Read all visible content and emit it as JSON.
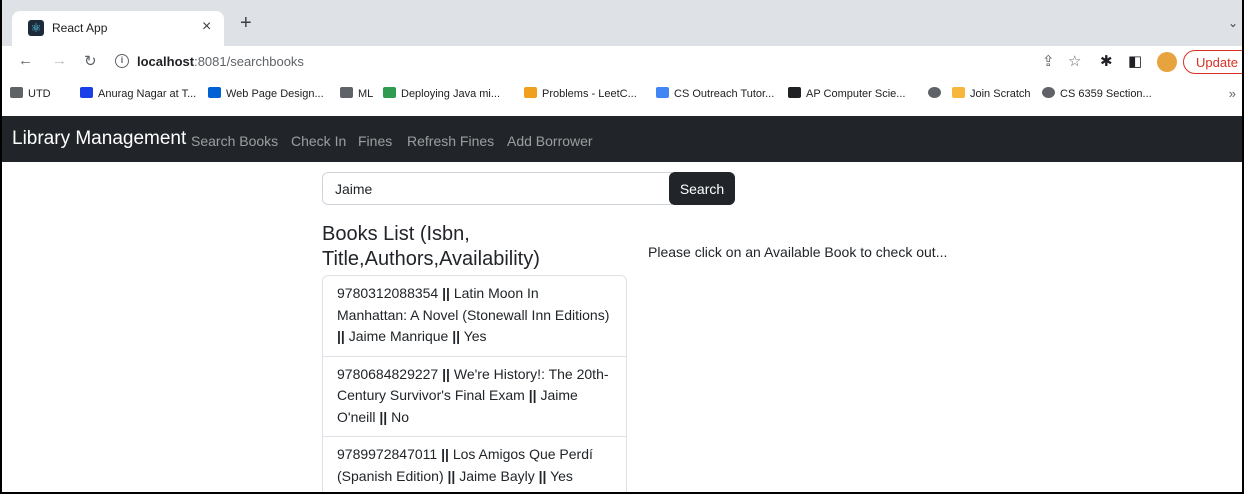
{
  "browser": {
    "tab_title": "React App",
    "url_host": "localhost",
    "url_rest": ":8081/searchbooks",
    "update_label": "Update",
    "bookmarks": [
      {
        "label": "UTD",
        "icon": "folder-icon",
        "color": "#5f6368"
      },
      {
        "label": "Anurag Nagar at T...",
        "icon": "flag-icon",
        "color": "#1a3ee8"
      },
      {
        "label": "Web Page Design...",
        "icon": "box-icon",
        "color": "#0061d5"
      },
      {
        "label": "ML",
        "icon": "folder-icon",
        "color": "#5f6368"
      },
      {
        "label": "Deploying Java mi...",
        "icon": "edge-icon",
        "color": "#2e9b4e"
      },
      {
        "label": "Problems - LeetC...",
        "icon": "leetcode-icon",
        "color": "#f0a01c"
      },
      {
        "label": "CS Outreach Tutor...",
        "icon": "docs-icon",
        "color": "#4285f4"
      },
      {
        "label": "AP Computer Scie...",
        "icon": "collegeboard-icon",
        "color": "#202124"
      },
      {
        "label": "",
        "icon": "globe-icon",
        "color": "#5f6368"
      },
      {
        "label": "Join Scratch",
        "icon": "scratch-icon",
        "color": "#f6b73c"
      },
      {
        "label": "CS 6359 Section...",
        "icon": "globe-icon",
        "color": "#5f6368"
      }
    ]
  },
  "app": {
    "brand": "Library Management",
    "nav": [
      "Search Books",
      "Check In",
      "Fines",
      "Refresh Fines",
      "Add Borrower"
    ]
  },
  "search": {
    "value": "Jaime",
    "button_label": "Search"
  },
  "books": {
    "title": "Books List (Isbn, Title,Authors,Availability)",
    "hint": "Please click on an Available Book to check out...",
    "items": [
      {
        "isbn": "9780312088354",
        "title": "Latin Moon In Manhattan: A Novel (Stonewall Inn Editions)",
        "authors": "Jaime Manrique",
        "available": "Yes"
      },
      {
        "isbn": "9780684829227",
        "title": "We're History!: The 20th-Century Survivor's Final Exam",
        "authors": "Jaime O'neill",
        "available": "No"
      },
      {
        "isbn": "9789972847011",
        "title": "Los Amigos Que Perdí (Spanish Edition)",
        "authors": "Jaime Bayly",
        "available": "Yes"
      }
    ],
    "separator": "||"
  }
}
